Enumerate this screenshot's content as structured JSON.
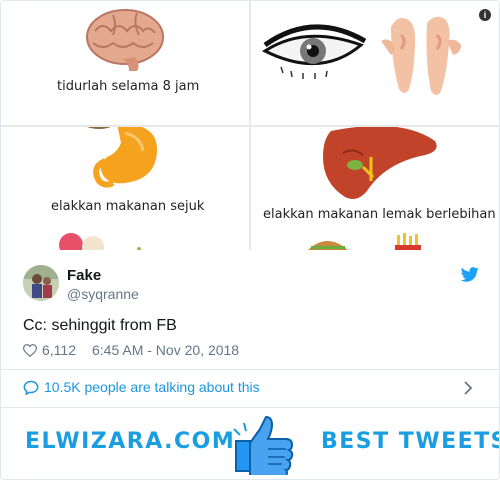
{
  "media": {
    "panel1_caption": "tidurlah selama 8 jam",
    "panel3_caption": "elakkan makanan sejuk",
    "panel4_caption": "elakkan makanan lemak berlebihan",
    "info_icon": "info-icon"
  },
  "author": {
    "name": "Fake",
    "handle": "@syqranne"
  },
  "tweet": {
    "text": "Cc: sehinggit from FB",
    "likes": "6,112",
    "timestamp": "6:45 AM - Nov 20, 2018"
  },
  "conversation": {
    "label": "10.5K people are talking about this"
  },
  "banner": {
    "left_text": "ELWIZARA.COM",
    "right_text": "BEST TWEETS"
  },
  "colors": {
    "accent": "#1b95e0",
    "text": "#14171a",
    "muted": "#657786",
    "border": "#e1e8ed"
  }
}
